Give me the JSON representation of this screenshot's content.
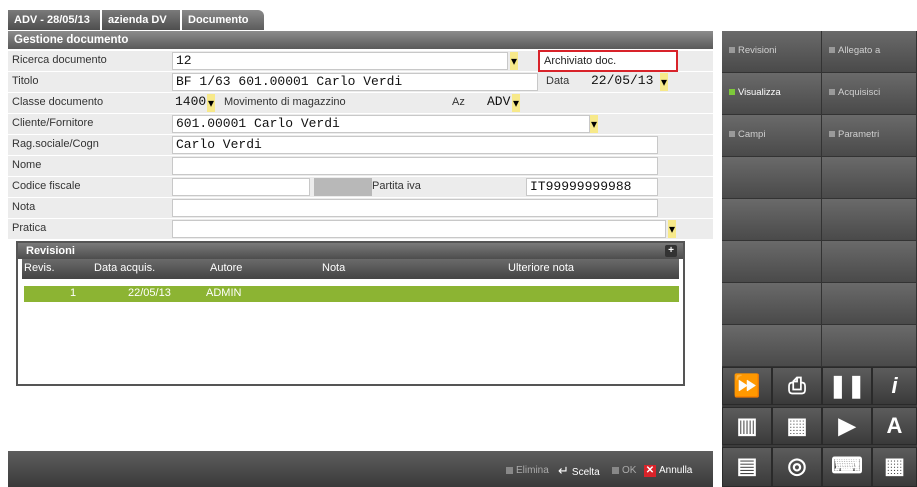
{
  "tabs": [
    "ADV - 28/05/13",
    "azienda DV",
    "Documento"
  ],
  "header": {
    "title": "Gestione documento"
  },
  "form": {
    "ricerca_label": "Ricerca documento",
    "ricerca_value": "12",
    "archiviato": "Archiviato doc.",
    "titolo_label": "Titolo",
    "titolo_value": "BF 1/63 601.00001 Carlo Verdi",
    "data_label": "Data",
    "data_value": "22/05/13",
    "classe_label": "Classe documento",
    "classe_value": "1400",
    "movimento_label": "Movimento di magazzino",
    "az_label": "Az",
    "az_value": "ADV",
    "cliente_label": "Cliente/Fornitore",
    "cliente_value": "601.00001 Carlo Verdi",
    "rag_label": "Rag.sociale/Cogn",
    "rag_value": "Carlo Verdi",
    "nome_label": "Nome",
    "cf_label": "Codice fiscale",
    "piva_label": "Partita iva",
    "piva_value": "IT99999999988",
    "nota_label": "Nota",
    "pratica_label": "Pratica"
  },
  "revisioni": {
    "title": "Revisioni",
    "columns": [
      "Revis.",
      "Data acquis.",
      "Autore",
      "Nota",
      "Ulteriore nota"
    ],
    "rows": [
      {
        "revis": "1",
        "data": "22/05/13",
        "autore": "ADMIN",
        "nota": "",
        "ulteriore": ""
      }
    ]
  },
  "bottombar": {
    "elimina": "Elimina",
    "scelta": "Scelta",
    "ok": "OK",
    "annulla": "Annulla"
  },
  "side": {
    "buttons": [
      "Revisioni",
      "Allegato a",
      "Visualizza",
      "Acquisisci",
      "Campi",
      "Parametri"
    ],
    "icons": [
      "fast-forward-icon",
      "document-search-icon",
      "pause-icon",
      "info-icon",
      "columns-icon",
      "calendar-icon",
      "play-icon",
      "font-icon",
      "message-icon",
      "sw-icon",
      "keyboard-icon",
      "grid-icon"
    ]
  },
  "colors": {
    "accent_green": "#8cb433",
    "highlight_red": "#d8232a",
    "dropdown_yellow": "#f7e98a"
  }
}
